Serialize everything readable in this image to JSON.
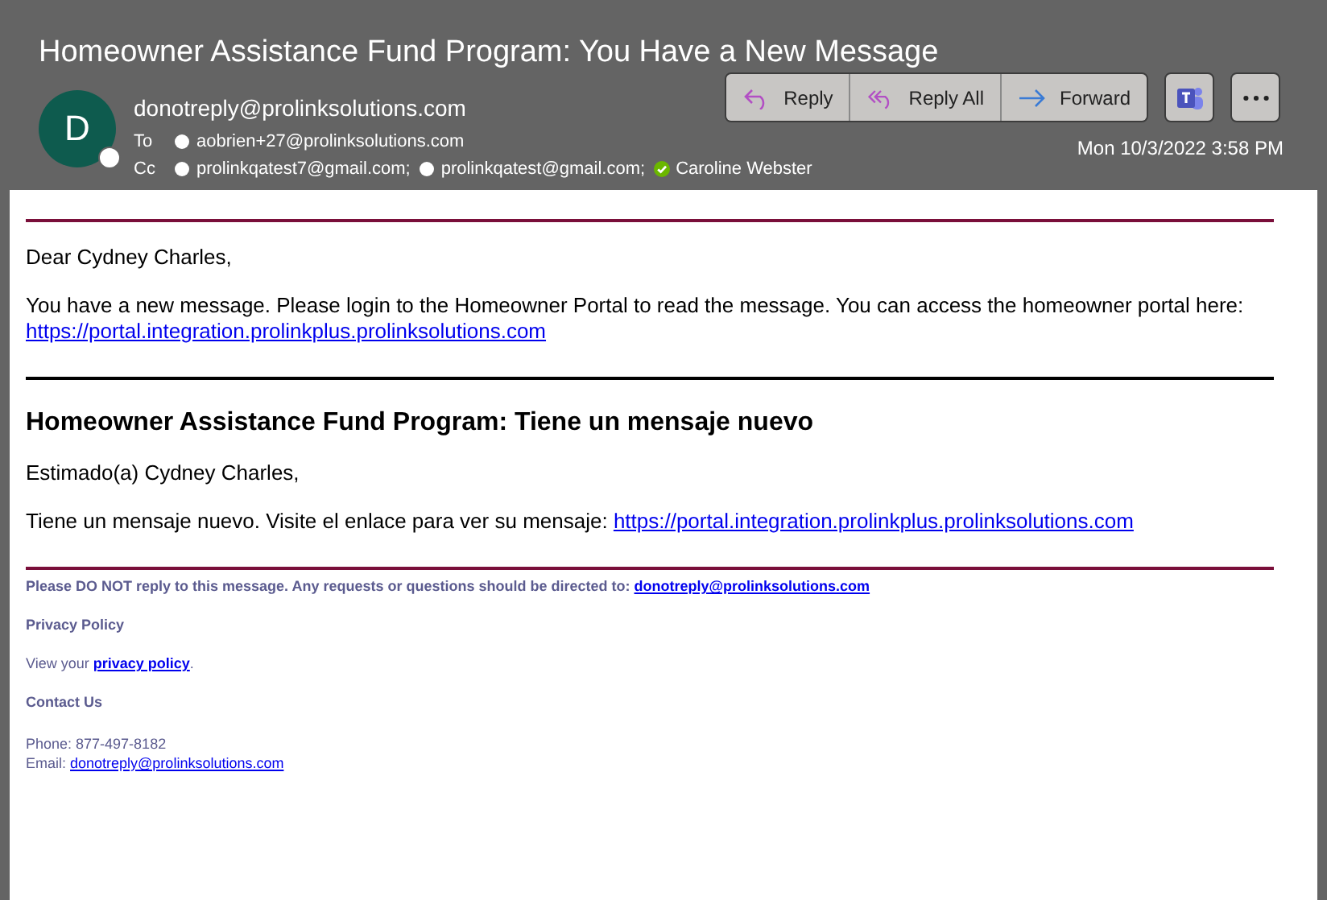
{
  "subject": "Homeowner Assistance Fund Program: You Have a New Message",
  "sender": {
    "initial": "D",
    "address": "donotreply@prolinksolutions.com"
  },
  "to": {
    "label": "To",
    "recipients": [
      {
        "address": "aobrien+27@prolinksolutions.com",
        "available": false
      }
    ]
  },
  "cc": {
    "label": "Cc",
    "recipients": [
      {
        "address": "prolinkqatest7@gmail.com;",
        "available": false
      },
      {
        "address": "prolinkqatest@gmail.com;",
        "available": false
      },
      {
        "address": "Caroline Webster",
        "available": true
      }
    ]
  },
  "actions": [
    {
      "label": "Reply",
      "kind": "reply"
    },
    {
      "label": "Reply All",
      "kind": "reply-all"
    },
    {
      "label": "Forward",
      "kind": "forward"
    }
  ],
  "date": "Mon 10/3/2022 3:58 PM",
  "body": {
    "greeting": "Dear Cydney Charles,",
    "message": {
      "text": "You have a new message. Please login to the Homeowner Portal to read the message. You can access the homeowner portal here: ",
      "link": "https://portal.integration.prolinkplus.prolinksolutions.com"
    },
    "heading_es": "Homeowner Assistance Fund Program: Tiene un mensaje nuevo",
    "greeting_es": "Estimado(a) Cydney Charles,",
    "message_es": {
      "text": "Tiene un mensaje nuevo. Visite el enlace para ver su mensaje: ",
      "link": "https://portal.integration.prolinkplus.prolinksolutions.com"
    }
  },
  "footer": {
    "notice": {
      "text": "Please DO NOT reply to this message. Any requests or questions should be directed to: ",
      "link": "donotreply@prolinksolutions.com"
    },
    "privacy_title": "Privacy Policy",
    "privacy": {
      "text": "View your ",
      "link": "privacy policy",
      "after": "."
    },
    "contact_title": "Contact Us",
    "phone": "Phone: 877-497-8182",
    "email": {
      "text": "Email: ",
      "link": "donotreply@prolinksolutions.com"
    }
  }
}
